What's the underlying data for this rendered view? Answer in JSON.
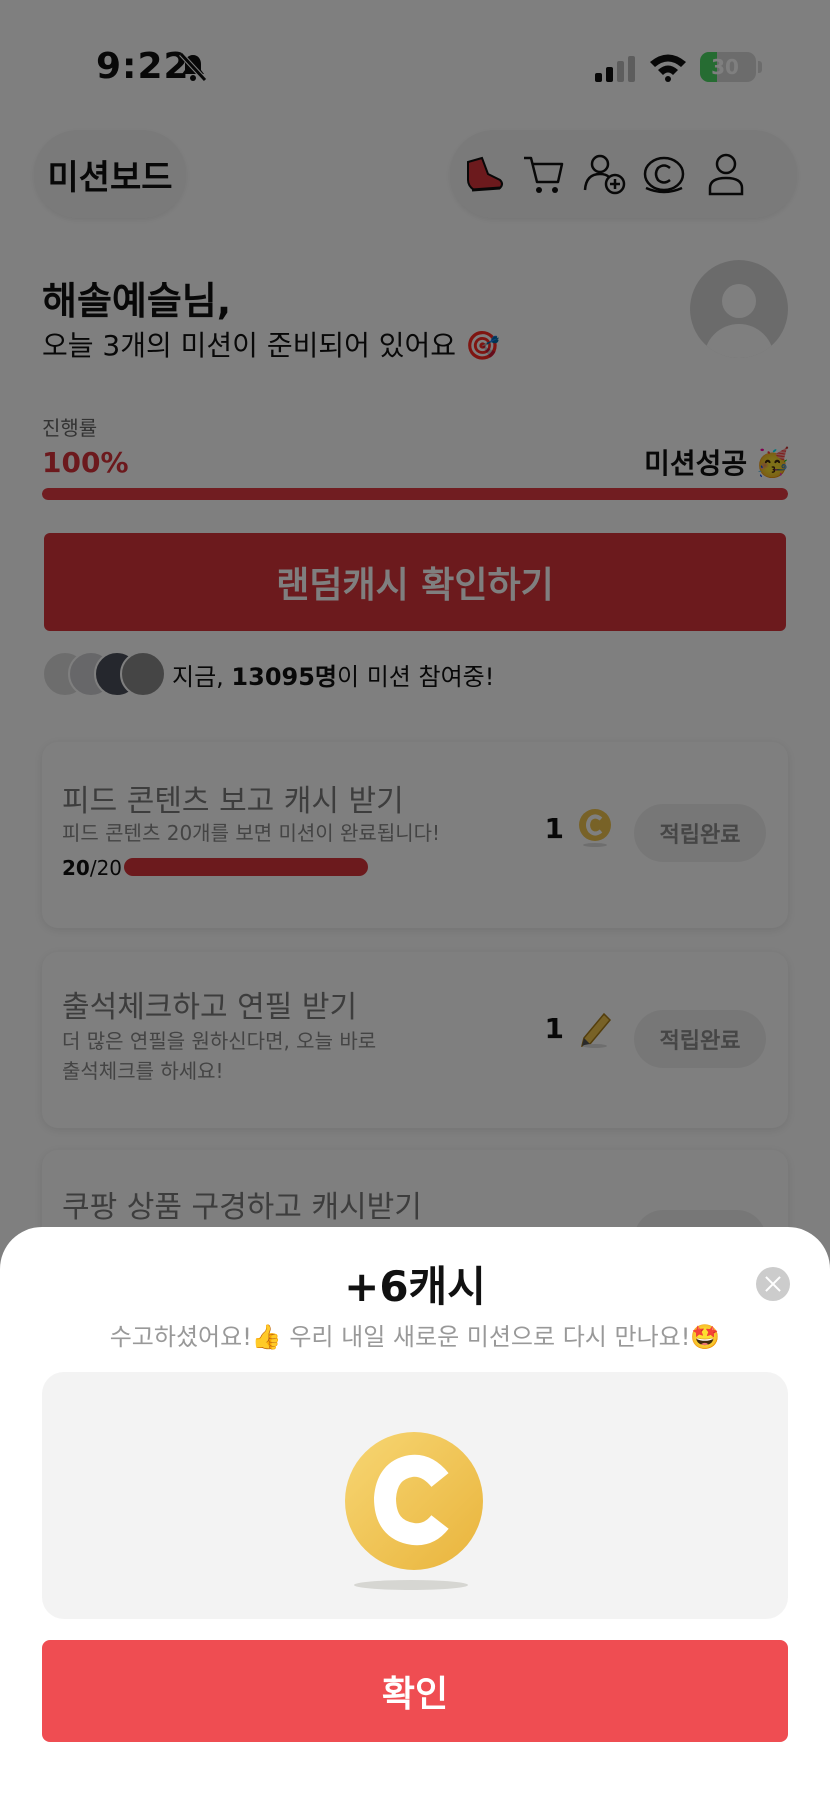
{
  "status_bar": {
    "time": "9:22",
    "battery": "30"
  },
  "header": {
    "brand": "미션보드",
    "icons": [
      "sneaker-icon",
      "cart-icon",
      "add-friend-icon",
      "cash-icon",
      "profile-icon"
    ]
  },
  "greeting": {
    "name": "해솔예슬님,",
    "subtitle": "오늘 3개의 미션이 준비되어 있어요 🎯"
  },
  "progress": {
    "label": "진행률",
    "value_text": "100%",
    "value": 1.0,
    "status": "미션성공",
    "status_emoji": "🥳"
  },
  "random_cash_button": "랜덤캐시 확인하기",
  "participants": {
    "prefix": "지금, ",
    "count": "13095명",
    "suffix": "이 미션 참여중!"
  },
  "missions": [
    {
      "title": "피드 콘텐츠 보고 캐시 받기",
      "description": "피드 콘텐츠 20개를 보면 미션이 완료됩니다!",
      "progress_current": "20",
      "progress_total": "/20",
      "progress_value": 1.0,
      "reward": "1",
      "reward_icon": "coin-icon",
      "button": "적립완료"
    },
    {
      "title": "출석체크하고 연필 받기",
      "description_line1": "더 많은 연필을 원하신다면, 오늘 바로",
      "description_line2": "출석체크를 하세요!",
      "reward": "1",
      "reward_icon": "pencil-icon",
      "button": "적립완료"
    },
    {
      "title": "쿠팡 상품 구경하고 캐시받기"
    }
  ],
  "modal": {
    "title": "+6캐시",
    "subtitle": "수고하셨어요!👍 우리 내일 새로운 미션으로 다시 만나요!🤩",
    "confirm_button": "확인"
  },
  "colors": {
    "accent": "#ef4d52",
    "accent_dark": "#d8343b",
    "coin": "#f0c54e"
  }
}
